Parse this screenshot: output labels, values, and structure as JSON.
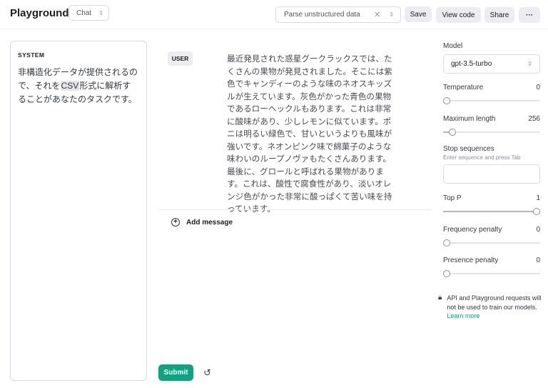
{
  "header": {
    "title": "Playground",
    "mode": "Chat",
    "preset": "Parse unstructured data",
    "save": "Save",
    "view_code": "View code",
    "share": "Share",
    "more": "···"
  },
  "system": {
    "label": "SYSTEM",
    "text_before": "非構造化データが提供されるので、それを",
    "text_highlight": "CSV",
    "text_after": "形式に解析することがあなたのタスクです。"
  },
  "messages": [
    {
      "role": "USER",
      "text": "最近発見された惑星グークラックスでは、たくさんの果物が発見されました。そこには紫色でキャンディーのような味のネオスキッズルが生えています。灰色がかった青色の果物であるローヘックルもあります。これは非常に酸味があり、少しレモンに似ています。ポニは明るい緑色で、甘いというよりも風味が強いです。ネオンピンク味で綿菓子のような味わいのループノヴァもたくさんあります。最後に、グロールと呼ばれる果物があります。これは、酸性で腐食性があり、淡いオレンジ色がかった非常に酸っぱくて苦い味を持っています。"
    }
  ],
  "add_message": "Add message",
  "submit": "Submit",
  "settings": {
    "model_label": "Model",
    "model": "gpt-3.5-turbo",
    "temperature": {
      "label": "Temperature",
      "value": "0",
      "fraction": 0
    },
    "max_length": {
      "label": "Maximum length",
      "value": "256",
      "fraction": 0.06
    },
    "stop": {
      "label": "Stop sequences",
      "hint": "Enter sequence and press Tab"
    },
    "top_p": {
      "label": "Top P",
      "value": "1",
      "fraction": 1
    },
    "frequency": {
      "label": "Frequency penalty",
      "value": "0",
      "fraction": 0
    },
    "presence": {
      "label": "Presence penalty",
      "value": "0",
      "fraction": 0
    }
  },
  "notice": {
    "text": "API and Playground requests will not be used to train our models.",
    "link": "Learn more"
  },
  "colors": {
    "accent": "#10a37f"
  }
}
